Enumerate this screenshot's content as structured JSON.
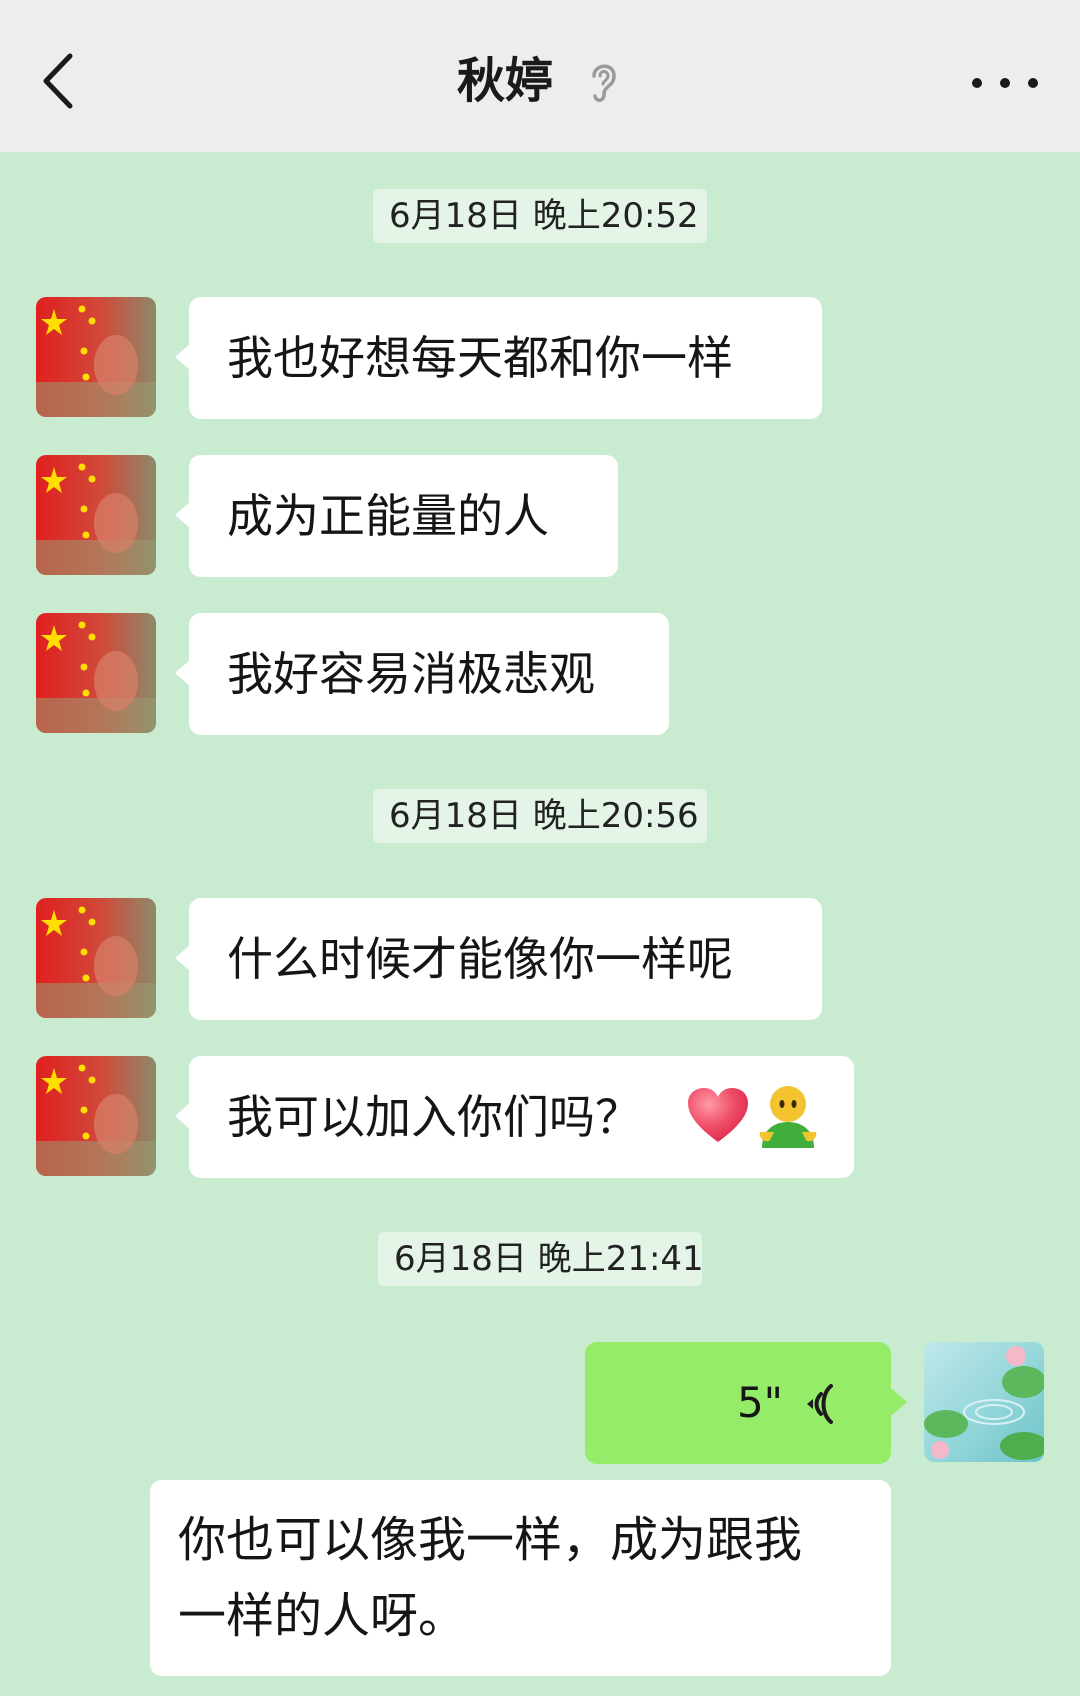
{
  "header": {
    "title": "秋婷",
    "back_icon": "chevron-left-icon",
    "ear_icon": "ear-icon",
    "more_icon": "more-dots-icon"
  },
  "colors": {
    "header_bg": "#ededed",
    "chat_bg": "#c9ecd1",
    "bubble_in": "#ffffff",
    "bubble_out": "#95ec69",
    "timestamp_bg": "#e4f5e8"
  },
  "messages": [
    {
      "type": "timestamp",
      "text": "6月18日 晚上20:52"
    },
    {
      "type": "text",
      "sender": "other",
      "text": "我也好想每天都和你一样"
    },
    {
      "type": "text",
      "sender": "other",
      "text": "成为正能量的人"
    },
    {
      "type": "text",
      "sender": "other",
      "text": "我好容易消极悲观"
    },
    {
      "type": "timestamp",
      "text": "6月18日 晚上20:56"
    },
    {
      "type": "text",
      "sender": "other",
      "text": "什么时候才能像你一样呢"
    },
    {
      "type": "text",
      "sender": "other",
      "text": "我可以加入你们吗？",
      "emojis": [
        "heart-emoji",
        "person-emoji"
      ]
    },
    {
      "type": "timestamp",
      "text": "6月18日 晚上21:41"
    },
    {
      "type": "voice",
      "sender": "me",
      "duration": "5\""
    },
    {
      "type": "text",
      "sender": "me",
      "lines": [
        "你也可以像我一样，成为跟我",
        "一样的人呀。"
      ]
    }
  ]
}
